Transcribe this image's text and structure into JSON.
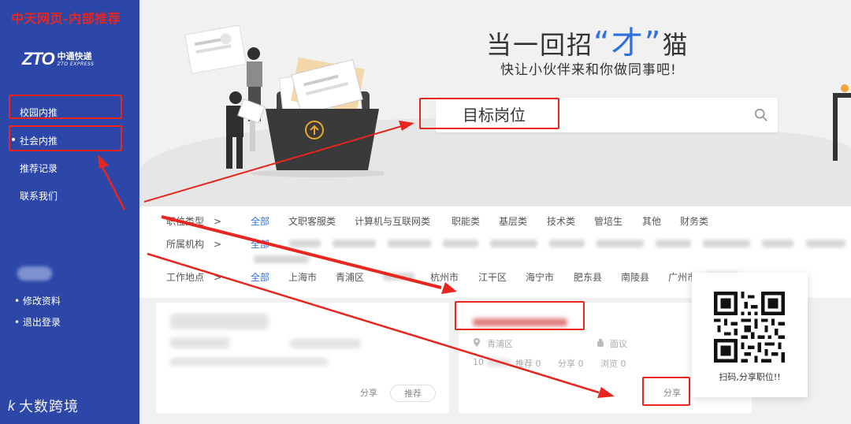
{
  "overlay_title": "中天网页-内部推荐",
  "sidebar": {
    "logo": {
      "mark": "ZTO",
      "cn": "中通快递",
      "en": "ZTO EXPRESS"
    },
    "nav": [
      "校园内推",
      "社会内推",
      "推荐记录",
      "联系我们"
    ],
    "bottom": [
      "• 修改资料",
      "• 退出登录"
    ]
  },
  "watermark": {
    "icon": "k",
    "text": "大数跨境"
  },
  "hero": {
    "headline_pre": "当一回招",
    "headline_hl": "“才”",
    "headline_post": "猫",
    "subheadline": "快让小伙伴来和你做同事吧!",
    "search_placeholder": "目标岗位"
  },
  "filters": {
    "job_type": {
      "label": "职位类型　>",
      "options": [
        "全部",
        "文职客服类",
        "计算机与互联网类",
        "职能类",
        "基层类",
        "技术类",
        "管培生",
        "其他",
        "财务类"
      ]
    },
    "org": {
      "label": "所属机构　>",
      "options": [
        "全部"
      ]
    },
    "location": {
      "label": "工作地点　>",
      "options": [
        "全部",
        "上海市",
        "青浦区",
        "",
        "杭州市",
        "江干区",
        "海宁市",
        "肥东县",
        "南陵县",
        "广州市"
      ]
    }
  },
  "cards": [
    {
      "share": "分享",
      "recommend": "推荐"
    },
    {
      "location": "青浦区",
      "salary": "面议",
      "prefix": "10",
      "recommend_count": "推荐 0",
      "share_count": "分享 0",
      "view_count": "浏览 0",
      "share": "分享"
    }
  ],
  "qr": {
    "caption": "扫码,分享职位!!"
  },
  "colors": {
    "sidebar": "#2c47a8",
    "accent": "#2f6fe0",
    "annotation": "#e8261f"
  }
}
